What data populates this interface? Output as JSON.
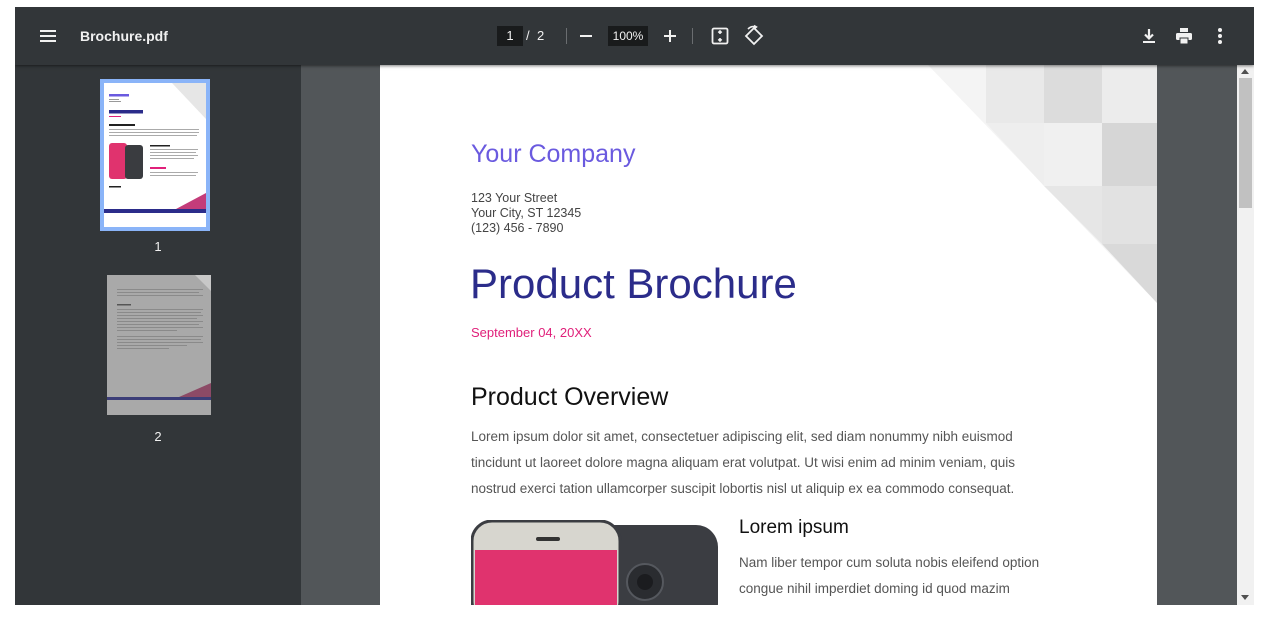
{
  "toolbar": {
    "title": "Brochure.pdf",
    "current_page": "1",
    "page_sep": "/",
    "total_pages": "2",
    "zoom": "100%",
    "icons": [
      "menu-icon",
      "zoom-out-icon",
      "zoom-in-icon",
      "fit-page-icon",
      "rotate-icon",
      "download-icon",
      "print-icon",
      "more-icon"
    ]
  },
  "sidebar": {
    "thumbnails": [
      {
        "label": "1",
        "selected": true
      },
      {
        "label": "2",
        "selected": false
      }
    ]
  },
  "document": {
    "company": "Your Company",
    "address_line1": "123 Your Street",
    "address_line2": "Your City, ST 12345",
    "phone": "(123) 456 - 7890",
    "title": "Product Brochure",
    "date": "September 04, 20XX",
    "overview_heading": "Product Overview",
    "overview_line1": "Lorem ipsum dolor sit amet, consectetuer adipiscing elit, sed diam nonummy nibh euismod",
    "overview_line2": "tincidunt ut laoreet dolore magna aliquam erat volutpat. Ut wisi enim ad minim veniam, quis",
    "overview_line3": "nostrud exerci tation ullamcorper suscipit lobortis nisl ut aliquip ex ea commodo consequat.",
    "sub_heading": "Lorem ipsum",
    "sub_line1": "Nam liber tempor cum soluta nobis eleifend option",
    "sub_line2": "congue nihil imperdiet doming id quod mazim"
  },
  "colors": {
    "toolbar_bg": "#323639",
    "viewer_bg": "#525659",
    "accent_purple": "#6a5adf",
    "title_navy": "#2b2c8a",
    "date_pink": "#e0207a",
    "thumb_selected": "#8ab4f8"
  }
}
